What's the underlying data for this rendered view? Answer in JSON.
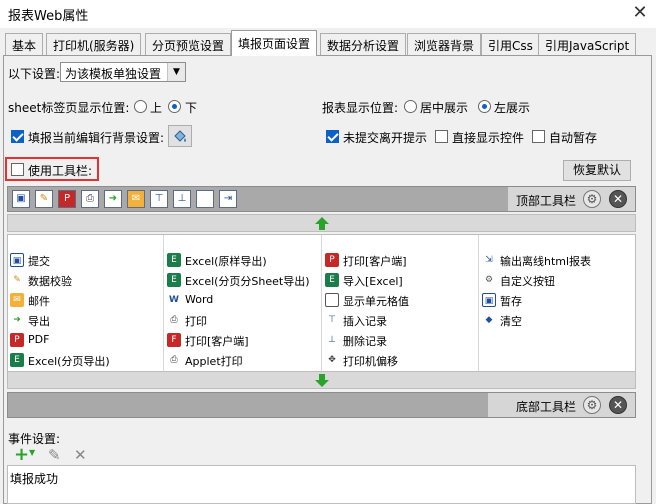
{
  "window": {
    "title": "报表Web属性",
    "close_glyph": "✕"
  },
  "tabs": [
    {
      "label": "基本",
      "active": false
    },
    {
      "label": "打印机(服务器)",
      "active": false
    },
    {
      "label": "分页预览设置",
      "active": false
    },
    {
      "label": "填报页面设置",
      "active": true
    },
    {
      "label": "数据分析设置",
      "active": false
    },
    {
      "label": "浏览器背景",
      "active": false
    },
    {
      "label": "引用Css",
      "active": false
    },
    {
      "label": "引用JavaScript",
      "active": false
    }
  ],
  "settings": {
    "scope_label": "以下设置:",
    "scope_value": "为该模板单独设置",
    "sheet_position_label": "sheet标签页显示位置:",
    "sheet_options": [
      "上",
      "下"
    ],
    "sheet_selected": "下",
    "report_position_label": "报表显示位置:",
    "report_options": [
      "居中展示",
      "左展示"
    ],
    "report_selected": "左展示",
    "checks": {
      "fill_bg": {
        "label": "填报当前编辑行背景设置:",
        "checked": true
      },
      "unsubmitted_prompt": {
        "label": "未提交离开提示",
        "checked": true
      },
      "direct_controls": {
        "label": "直接显示控件",
        "checked": false
      },
      "auto_save": {
        "label": "自动暂存",
        "checked": false
      },
      "use_toolbar": {
        "label": "使用工具栏:",
        "checked": false
      }
    },
    "restore_default_label": "恢复默认"
  },
  "toolbar": {
    "top_label": "顶部工具栏",
    "bottom_label": "底部工具栏",
    "top_icons": [
      "save-icon",
      "validate-icon",
      "pdf-icon",
      "print-icon",
      "export-icon",
      "mail-icon",
      "insert-icon",
      "delete-icon",
      "blank-icon",
      "exit-icon"
    ]
  },
  "buttons_grid": {
    "columns": [
      [
        {
          "label": "提交",
          "icon": "submit-icon"
        },
        {
          "label": "数据校验",
          "icon": "validate-icon"
        },
        {
          "label": "邮件",
          "icon": "mail-icon"
        },
        {
          "label": "导出",
          "icon": "export-icon"
        },
        {
          "label": "PDF",
          "icon": "pdf-icon"
        },
        {
          "label": "Excel(分页导出)",
          "icon": "excel-icon"
        }
      ],
      [
        {
          "label": "Excel(原样导出)",
          "icon": "excel-icon"
        },
        {
          "label": "Excel(分页分Sheet导出)",
          "icon": "excel-icon"
        },
        {
          "label": "Word",
          "icon": "word-icon"
        },
        {
          "label": "打印",
          "icon": "print-icon"
        },
        {
          "label": "打印[客户端]",
          "icon": "flash-print-icon"
        },
        {
          "label": "Applet打印",
          "icon": "applet-print-icon"
        }
      ],
      [
        {
          "label": "打印[客户端]",
          "icon": "pdf-icon"
        },
        {
          "label": "导入[Excel]",
          "icon": "excel-icon"
        },
        {
          "label": "显示单元格值",
          "icon": "cell-icon"
        },
        {
          "label": "插入记录",
          "icon": "insert-icon"
        },
        {
          "label": "删除记录",
          "icon": "delete-icon"
        },
        {
          "label": "打印机偏移",
          "icon": "move-icon"
        }
      ],
      [
        {
          "label": "输出离线html报表",
          "icon": "offline-html-icon"
        },
        {
          "label": "自定义按钮",
          "icon": "gear-icon"
        },
        {
          "label": "暂存",
          "icon": "save-icon"
        },
        {
          "label": "清空",
          "icon": "eraser-icon"
        }
      ]
    ]
  },
  "events": {
    "label": "事件设置:",
    "add_glyph": "+",
    "edit_glyph": "✎",
    "remove_glyph": "✕",
    "item": "填报成功"
  },
  "colors": {
    "accent": "#0b61c7",
    "green": "#2aa32a",
    "red_outline": "#e83030",
    "bar": "#a9a9a9"
  }
}
